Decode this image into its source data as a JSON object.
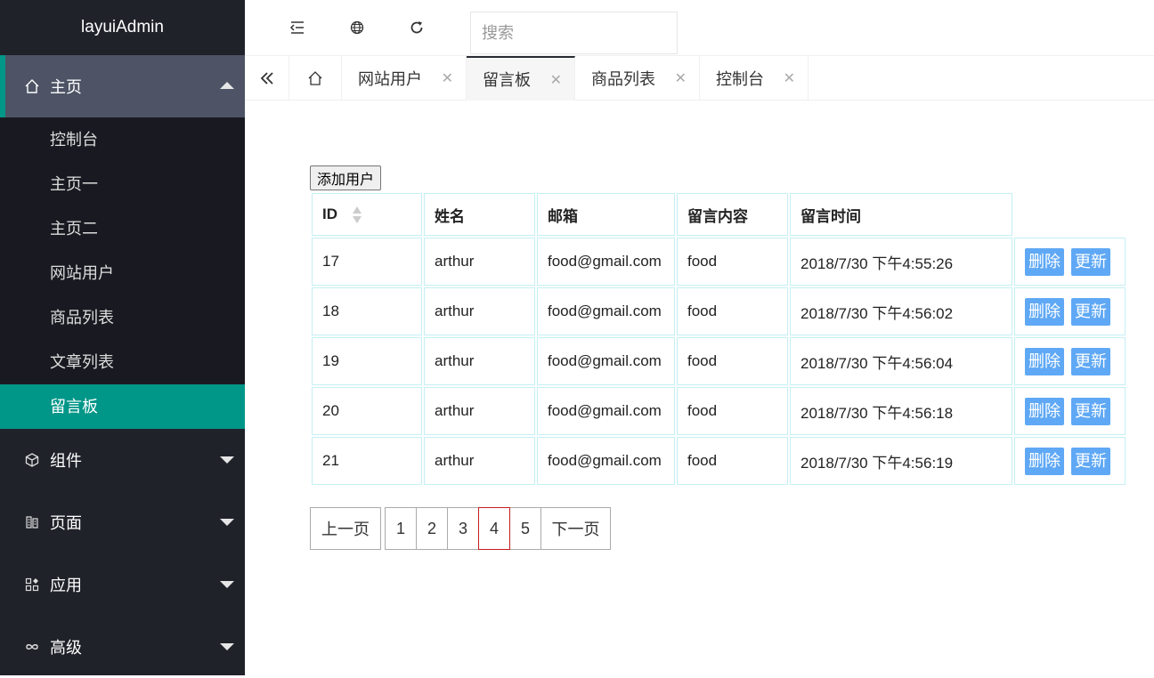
{
  "app": {
    "title": "layuiAdmin"
  },
  "sidebar": {
    "home": {
      "label": "主页",
      "icon": "home-icon"
    },
    "sub_items": [
      {
        "label": "控制台"
      },
      {
        "label": "主页一"
      },
      {
        "label": "主页二"
      },
      {
        "label": "网站用户"
      },
      {
        "label": "商品列表"
      },
      {
        "label": "文章列表"
      },
      {
        "label": "留言板"
      }
    ],
    "groups": [
      {
        "label": "组件",
        "icon": "cube-icon"
      },
      {
        "label": "页面",
        "icon": "page-icon"
      },
      {
        "label": "应用",
        "icon": "apps-icon"
      },
      {
        "label": "高级",
        "icon": "infinity-icon"
      }
    ]
  },
  "header": {
    "search": {
      "placeholder": "搜索"
    }
  },
  "tabs": [
    {
      "label": "网站用户"
    },
    {
      "label": "留言板"
    },
    {
      "label": "商品列表"
    },
    {
      "label": "控制台"
    }
  ],
  "main": {
    "add_button": "添加用户",
    "columns": [
      "ID",
      "姓名",
      "邮箱",
      "留言内容",
      "留言时间"
    ],
    "rows": [
      {
        "id": "17",
        "name": "arthur",
        "email": "food@gmail.com",
        "content": "food",
        "time": "2018/7/30 下午4:55:26"
      },
      {
        "id": "18",
        "name": "arthur",
        "email": "food@gmail.com",
        "content": "food",
        "time": "2018/7/30 下午4:56:02"
      },
      {
        "id": "19",
        "name": "arthur",
        "email": "food@gmail.com",
        "content": "food",
        "time": "2018/7/30 下午4:56:04"
      },
      {
        "id": "20",
        "name": "arthur",
        "email": "food@gmail.com",
        "content": "food",
        "time": "2018/7/30 下午4:56:18"
      },
      {
        "id": "21",
        "name": "arthur",
        "email": "food@gmail.com",
        "content": "food",
        "time": "2018/7/30 下午4:56:19"
      }
    ],
    "delete_label": "删除",
    "update_label": "更新"
  },
  "pagination": {
    "prev": "上一页",
    "pages": [
      "1",
      "2",
      "3",
      "4",
      "5"
    ],
    "current": "4",
    "next": "下一页"
  },
  "colors": {
    "sidebar_bg": "#20222a",
    "accent": "#009688",
    "action_button": "#5fa8f5",
    "current_page_border": "#c51e1e",
    "table_border": "#c4eff4"
  }
}
